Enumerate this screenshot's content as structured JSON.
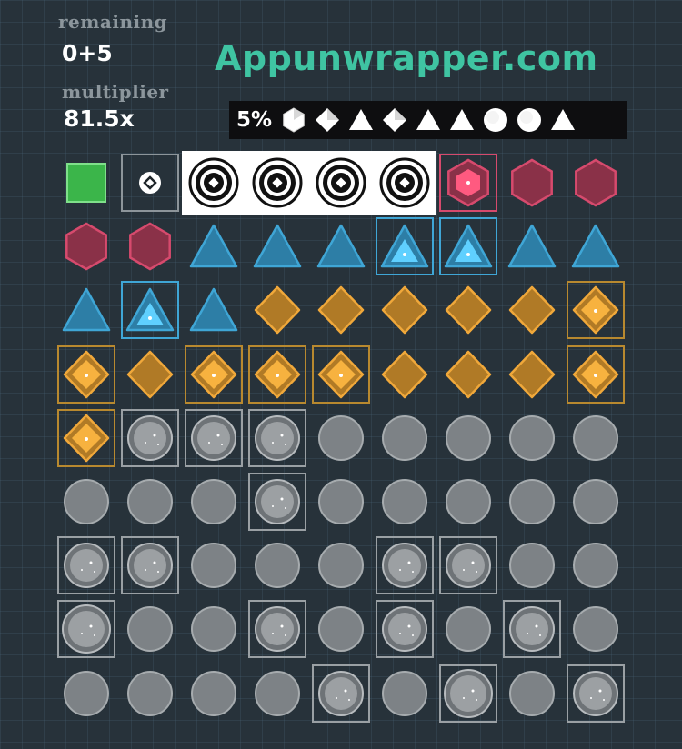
{
  "hud": {
    "remaining_label": "remaining",
    "remaining_value": "0+5",
    "multiplier_label": "multiplier",
    "multiplier_value": "81.5x"
  },
  "watermark": "Appunwrapper.com",
  "goal": {
    "percent": "5%",
    "icons": [
      "hexagon",
      "diamond",
      "triangle",
      "diamond",
      "triangle",
      "triangle",
      "circle",
      "circle",
      "triangle"
    ]
  },
  "colors": {
    "green": "#3bb54a",
    "hexagon": "#d64a6d",
    "triangle": "#3fa6d6",
    "diamond": "#f0a83a",
    "circle": "#8a8f93",
    "selected": "#ffffff"
  },
  "board": {
    "columns": 9,
    "rows": [
      [
        {
          "t": "square"
        },
        {
          "t": "ring"
        },
        {
          "t": "target",
          "sel": true
        },
        {
          "t": "target",
          "sel": true
        },
        {
          "t": "target",
          "sel": true
        },
        {
          "t": "target",
          "sel": true
        },
        {
          "t": "hexagon",
          "hl": true
        },
        {
          "t": "hexagon"
        },
        {
          "t": "hexagon"
        }
      ],
      [
        {
          "t": "hexagon"
        },
        {
          "t": "hexagon"
        },
        {
          "t": "triangle"
        },
        {
          "t": "triangle"
        },
        {
          "t": "triangle"
        },
        {
          "t": "triangle",
          "hl": true
        },
        {
          "t": "triangle",
          "hl": true
        },
        {
          "t": "triangle"
        },
        {
          "t": "triangle"
        }
      ],
      [
        {
          "t": "triangle"
        },
        {
          "t": "triangle",
          "hl": true
        },
        {
          "t": "triangle"
        },
        {
          "t": "diamond"
        },
        {
          "t": "diamond"
        },
        {
          "t": "diamond"
        },
        {
          "t": "diamond"
        },
        {
          "t": "diamond"
        },
        {
          "t": "diamond",
          "hl": true
        }
      ],
      [
        {
          "t": "diamond",
          "hl": true
        },
        {
          "t": "diamond"
        },
        {
          "t": "diamond",
          "hl": true
        },
        {
          "t": "diamond",
          "hl": true
        },
        {
          "t": "diamond",
          "hl": true
        },
        {
          "t": "diamond"
        },
        {
          "t": "diamond"
        },
        {
          "t": "diamond"
        },
        {
          "t": "diamond",
          "hl": true
        }
      ],
      [
        {
          "t": "diamond",
          "hl": true
        },
        {
          "t": "circle",
          "hl": true
        },
        {
          "t": "circle",
          "hl": true
        },
        {
          "t": "circle",
          "hl": true
        },
        {
          "t": "circle"
        },
        {
          "t": "circle"
        },
        {
          "t": "circle"
        },
        {
          "t": "circle"
        },
        {
          "t": "circle"
        }
      ],
      [
        {
          "t": "circle"
        },
        {
          "t": "circle"
        },
        {
          "t": "circle"
        },
        {
          "t": "circle",
          "hl": true
        },
        {
          "t": "circle"
        },
        {
          "t": "circle"
        },
        {
          "t": "circle"
        },
        {
          "t": "circle"
        },
        {
          "t": "circle"
        }
      ],
      [
        {
          "t": "circle",
          "hl": true
        },
        {
          "t": "circle",
          "hl": true
        },
        {
          "t": "circle"
        },
        {
          "t": "circle"
        },
        {
          "t": "circle"
        },
        {
          "t": "circle",
          "hl": true
        },
        {
          "t": "circle",
          "hl": true
        },
        {
          "t": "circle"
        },
        {
          "t": "circle"
        }
      ],
      [
        {
          "t": "circle",
          "hl": true,
          "big": true
        },
        {
          "t": "circle"
        },
        {
          "t": "circle"
        },
        {
          "t": "circle",
          "hl": true
        },
        {
          "t": "circle"
        },
        {
          "t": "circle",
          "hl": true
        },
        {
          "t": "circle"
        },
        {
          "t": "circle",
          "hl": true
        },
        {
          "t": "circle"
        }
      ],
      [
        {
          "t": "circle"
        },
        {
          "t": "circle"
        },
        {
          "t": "circle"
        },
        {
          "t": "circle"
        },
        {
          "t": "circle",
          "hl": true
        },
        {
          "t": "circle"
        },
        {
          "t": "circle",
          "hl": true,
          "big": true
        },
        {
          "t": "circle"
        },
        {
          "t": "circle",
          "hl": true
        }
      ]
    ]
  }
}
